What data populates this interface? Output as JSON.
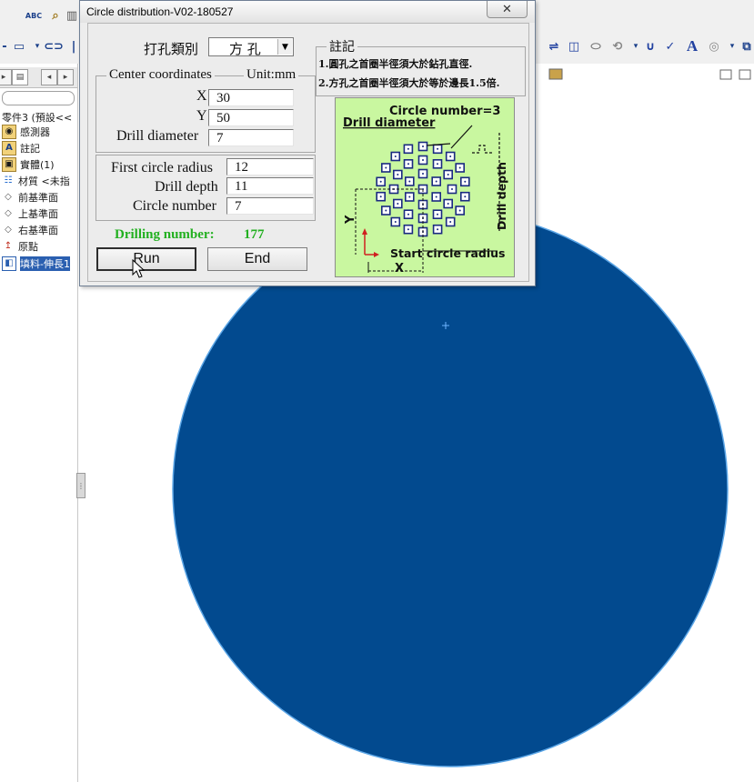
{
  "dialog": {
    "title": "Circle distribution-V02-180527",
    "close_icon": "close-icon",
    "hole_type_label": "打孔類別",
    "hole_type_value": "方 孔",
    "center_group_title": "Center coordinates",
    "unit_label": "Unit:mm",
    "x_label": "X",
    "x_value": "30",
    "y_label": "Y",
    "y_value": "50",
    "drill_diameter_label": "Drill diameter",
    "drill_diameter_value": "7",
    "first_circle_radius_label": "First circle radius",
    "first_circle_radius_value": "12",
    "drill_depth_label": "Drill depth",
    "drill_depth_value": "11",
    "circle_number_label": "Circle number",
    "circle_number_value": "7",
    "drilling_number_label": "Drilling number:",
    "drilling_number_value": "177",
    "run_button": "Run",
    "end_button": "End",
    "notes_title": "註記",
    "note_1": "1.圓孔之首圈半徑須大於鉆孔直徑.",
    "note_2": "2.方孔之首圈半徑須大於等於邊長1.5倍.",
    "illustration": {
      "circle_number_text": "Circle number=3",
      "drill_diameter_text": "Drill diameter",
      "drill_depth_text": "Drill depth",
      "start_radius_text": "Start circle radius",
      "x_axis_text": "X",
      "y_axis_text": "Y",
      "background_color": "#c9f7a0"
    }
  },
  "feature_tree": {
    "items": [
      {
        "label": "零件3 (預設<<",
        "icon": "part-icon"
      },
      {
        "label": "感測器",
        "icon": "sensor-icon"
      },
      {
        "label": "註記",
        "icon": "annotation-icon"
      },
      {
        "label": "實體(1)",
        "icon": "solid-body-icon"
      },
      {
        "label": "材質 <未指",
        "icon": "material-icon"
      },
      {
        "label": "前基準面",
        "icon": "plane-icon"
      },
      {
        "label": "上基準面",
        "icon": "plane-icon"
      },
      {
        "label": "右基準面",
        "icon": "plane-icon"
      },
      {
        "label": "原點",
        "icon": "origin-icon"
      },
      {
        "label": "填料-伸長1",
        "icon": "extrude-icon",
        "selected": true
      }
    ]
  },
  "toolbar": {
    "spell_check_label": "ABC",
    "text_icon_label": "A"
  },
  "colors": {
    "disc_fill": "#024a8f",
    "disc_edge": "#5aa5e6",
    "drilling_number": "#22b020",
    "tree_selected": "#2a5fb0"
  }
}
